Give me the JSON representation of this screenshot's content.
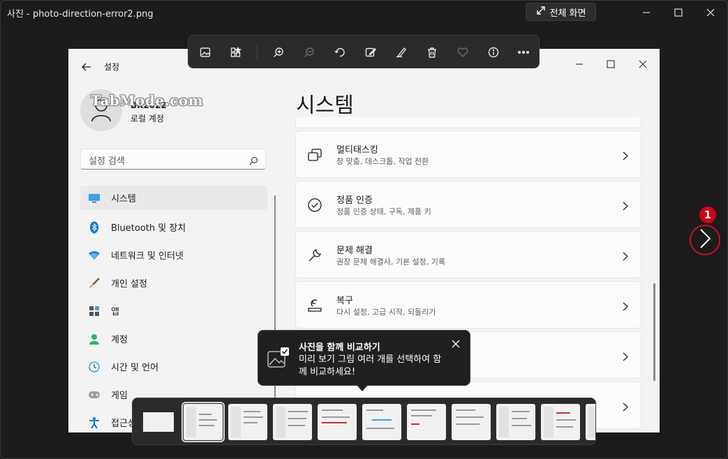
{
  "window": {
    "app_title": "사진 - photo-direction-error2.png",
    "fullscreen_label": "전체 화면"
  },
  "photo": {
    "window_title": "설정",
    "user_name": "BK2022",
    "user_sub": "로컬 계정",
    "watermark": "TabMode.com",
    "search_placeholder": "설정 검색",
    "nav": [
      {
        "label": "시스템",
        "icon": "monitor-icon",
        "active": true
      },
      {
        "label": "Bluetooth 및 장치",
        "icon": "bluetooth-icon"
      },
      {
        "label": "네트워크 및 인터넷",
        "icon": "wifi-icon"
      },
      {
        "label": "개인 설정",
        "icon": "brush-icon"
      },
      {
        "label": "앱",
        "icon": "apps-icon"
      },
      {
        "label": "계정",
        "icon": "account-icon"
      },
      {
        "label": "시간 및 언어",
        "icon": "clock-icon"
      },
      {
        "label": "게임",
        "icon": "gamepad-icon"
      },
      {
        "label": "접근성",
        "icon": "accessibility-icon"
      }
    ],
    "heading": "시스템",
    "cards": [
      {
        "title": "멀티태스킹",
        "sub": "창 맞춤, 데스크톱, 작업 전환",
        "icon": "multitask-icon"
      },
      {
        "title": "정품 인증",
        "sub": "정품 인증 상태, 구독, 제품 키",
        "icon": "check-circle-icon"
      },
      {
        "title": "문제 해결",
        "sub": "권장 문제 해결사, 기본 설정, 기록",
        "icon": "wrench-icon"
      },
      {
        "title": "복구",
        "sub": "다시 설정, 고급 시작, 되돌리기",
        "icon": "recovery-icon"
      },
      {
        "title": "",
        "sub": "",
        "icon": ""
      },
      {
        "title": "",
        "sub": "",
        "icon": ""
      }
    ]
  },
  "toolbar": {
    "items": [
      "photo-icon",
      "collection-icon",
      "zoom-in-icon",
      "zoom-out-icon",
      "rotate-icon",
      "edit-icon",
      "draw-icon",
      "delete-icon",
      "favorite-icon",
      "info-icon",
      "more-icon"
    ]
  },
  "next": {
    "badge": "1"
  },
  "tooltip": {
    "title": "사진을 함께 비교하기",
    "body": "미리 보기 그림 여러 개를 선택하여 함께 비교하세요!"
  },
  "filmstrip": {
    "count": 11,
    "selected_index": 1
  },
  "colors": {
    "accent": "#005fb8",
    "badge": "#d0021b"
  }
}
